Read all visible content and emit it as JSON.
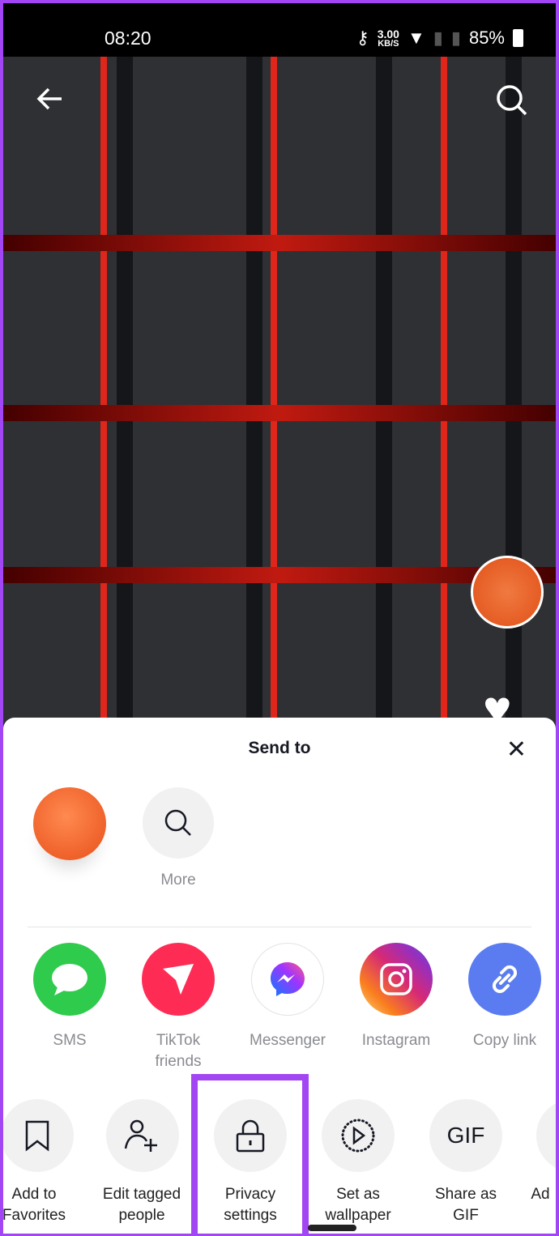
{
  "status_bar": {
    "time": "08:20",
    "net_speed": "3.00",
    "net_unit": "KB/S",
    "battery": "85%"
  },
  "video": {
    "back_icon": "arrow-left-icon",
    "search_icon": "search-icon"
  },
  "sheet": {
    "title": "Send to",
    "contacts": [
      {
        "label": ""
      },
      {
        "label": "More"
      }
    ],
    "share_targets": [
      {
        "label": "SMS",
        "color": "#2fcb4c"
      },
      {
        "label": "TikTok friends",
        "line1": "TikTok",
        "line2": "friends",
        "color": "#fe2c55"
      },
      {
        "label": "Messenger",
        "color": "#ffffff"
      },
      {
        "label": "Instagram",
        "color": "#d62976"
      },
      {
        "label": "Copy link",
        "color": "#5a7cf0"
      }
    ],
    "actions": [
      {
        "line1": "Add to",
        "line2": "Favorites"
      },
      {
        "line1": "Edit tagged",
        "line2": "people"
      },
      {
        "line1": "Privacy",
        "line2": "settings"
      },
      {
        "line1": "Set as",
        "line2": "wallpaper"
      },
      {
        "line1": "Share as",
        "line2": "GIF",
        "icon_text": "GIF"
      },
      {
        "line1": "Ad",
        "line2": ""
      }
    ]
  },
  "highlight_color": "#a245f2"
}
